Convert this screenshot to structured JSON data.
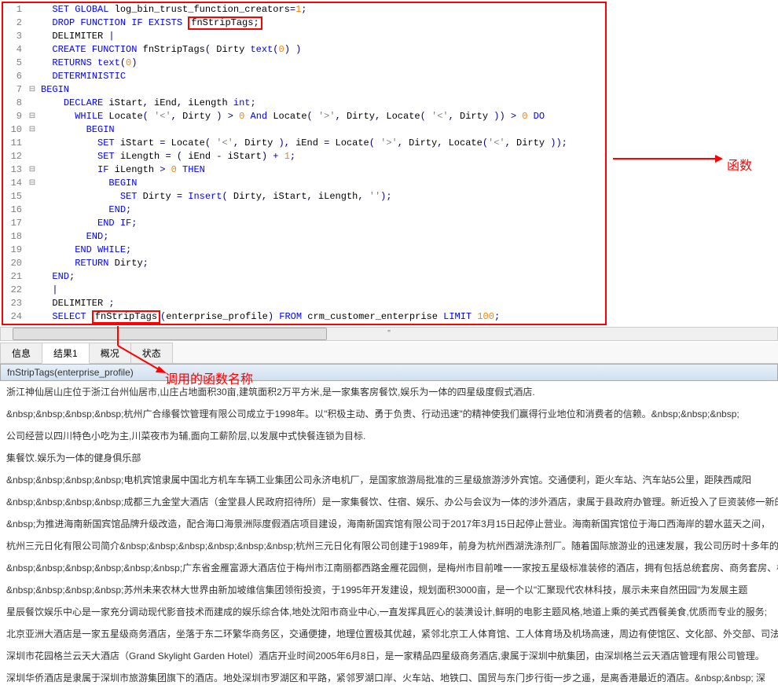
{
  "code": {
    "lines": [
      {
        "n": 1,
        "fold": "",
        "tokens": [
          {
            "t": "  ",
            "c": ""
          },
          {
            "t": "SET GLOBAL",
            "c": "kw"
          },
          {
            "t": " log_bin_trust_function_creators",
            "c": "id"
          },
          {
            "t": "=",
            "c": "op"
          },
          {
            "t": "1",
            "c": "num"
          },
          {
            "t": ";",
            "c": "op"
          }
        ]
      },
      {
        "n": 2,
        "fold": "",
        "tokens": [
          {
            "t": "  ",
            "c": ""
          },
          {
            "t": "DROP FUNCTION IF EXISTS",
            "c": "kw"
          },
          {
            "t": " ",
            "c": ""
          },
          {
            "t": "fnStripTags;",
            "c": "id",
            "box": true
          }
        ]
      },
      {
        "n": 3,
        "fold": "",
        "tokens": [
          {
            "t": "  DELIMITER ",
            "c": "id"
          },
          {
            "t": "|",
            "c": "op"
          }
        ]
      },
      {
        "n": 4,
        "fold": "",
        "tokens": [
          {
            "t": "  ",
            "c": ""
          },
          {
            "t": "CREATE FUNCTION",
            "c": "kw"
          },
          {
            "t": " fnStripTags",
            "c": "id"
          },
          {
            "t": "(",
            "c": "op"
          },
          {
            "t": " Dirty ",
            "c": "id"
          },
          {
            "t": "text",
            "c": "kw"
          },
          {
            "t": "(",
            "c": "op"
          },
          {
            "t": "0",
            "c": "num"
          },
          {
            "t": ") )",
            "c": "op"
          }
        ]
      },
      {
        "n": 5,
        "fold": "",
        "tokens": [
          {
            "t": "  ",
            "c": ""
          },
          {
            "t": "RETURNS",
            "c": "kw"
          },
          {
            "t": " ",
            "c": ""
          },
          {
            "t": "text",
            "c": "kw"
          },
          {
            "t": "(",
            "c": "op"
          },
          {
            "t": "0",
            "c": "num"
          },
          {
            "t": ")",
            "c": "op"
          }
        ]
      },
      {
        "n": 6,
        "fold": "",
        "tokens": [
          {
            "t": "  ",
            "c": ""
          },
          {
            "t": "DETERMINISTIC",
            "c": "kw"
          }
        ]
      },
      {
        "n": 7,
        "fold": "⊟",
        "tokens": [
          {
            "t": "BEGIN",
            "c": "kw"
          }
        ]
      },
      {
        "n": 8,
        "fold": "",
        "tokens": [
          {
            "t": "    ",
            "c": ""
          },
          {
            "t": "DECLARE",
            "c": "kw"
          },
          {
            "t": " iStart",
            "c": "id"
          },
          {
            "t": ",",
            "c": "op"
          },
          {
            "t": " iEnd",
            "c": "id"
          },
          {
            "t": ",",
            "c": "op"
          },
          {
            "t": " iLength ",
            "c": "id"
          },
          {
            "t": "int",
            "c": "kw"
          },
          {
            "t": ";",
            "c": "op"
          }
        ]
      },
      {
        "n": 9,
        "fold": "⊟",
        "tokens": [
          {
            "t": "      ",
            "c": ""
          },
          {
            "t": "WHILE",
            "c": "kw"
          },
          {
            "t": " Locate",
            "c": "id"
          },
          {
            "t": "( ",
            "c": "op"
          },
          {
            "t": "'<'",
            "c": "str"
          },
          {
            "t": ",",
            "c": "op"
          },
          {
            "t": " Dirty ",
            "c": "id"
          },
          {
            "t": ") > ",
            "c": "op"
          },
          {
            "t": "0",
            "c": "num"
          },
          {
            "t": " ",
            "c": ""
          },
          {
            "t": "And",
            "c": "kw"
          },
          {
            "t": " Locate",
            "c": "id"
          },
          {
            "t": "( ",
            "c": "op"
          },
          {
            "t": "'>'",
            "c": "str"
          },
          {
            "t": ",",
            "c": "op"
          },
          {
            "t": " Dirty",
            "c": "id"
          },
          {
            "t": ",",
            "c": "op"
          },
          {
            "t": " Locate",
            "c": "id"
          },
          {
            "t": "( ",
            "c": "op"
          },
          {
            "t": "'<'",
            "c": "str"
          },
          {
            "t": ",",
            "c": "op"
          },
          {
            "t": " Dirty ",
            "c": "id"
          },
          {
            "t": ")) > ",
            "c": "op"
          },
          {
            "t": "0",
            "c": "num"
          },
          {
            "t": " ",
            "c": ""
          },
          {
            "t": "DO",
            "c": "kw"
          }
        ]
      },
      {
        "n": 10,
        "fold": "⊟",
        "tokens": [
          {
            "t": "        ",
            "c": ""
          },
          {
            "t": "BEGIN",
            "c": "kw"
          }
        ]
      },
      {
        "n": 11,
        "fold": "",
        "tokens": [
          {
            "t": "          ",
            "c": ""
          },
          {
            "t": "SET",
            "c": "kw"
          },
          {
            "t": " iStart ",
            "c": "id"
          },
          {
            "t": "=",
            "c": "op"
          },
          {
            "t": " Locate",
            "c": "id"
          },
          {
            "t": "( ",
            "c": "op"
          },
          {
            "t": "'<'",
            "c": "str"
          },
          {
            "t": ",",
            "c": "op"
          },
          {
            "t": " Dirty ",
            "c": "id"
          },
          {
            "t": "),",
            "c": "op"
          },
          {
            "t": " iEnd ",
            "c": "id"
          },
          {
            "t": "=",
            "c": "op"
          },
          {
            "t": " Locate",
            "c": "id"
          },
          {
            "t": "( ",
            "c": "op"
          },
          {
            "t": "'>'",
            "c": "str"
          },
          {
            "t": ",",
            "c": "op"
          },
          {
            "t": " Dirty",
            "c": "id"
          },
          {
            "t": ",",
            "c": "op"
          },
          {
            "t": " Locate",
            "c": "id"
          },
          {
            "t": "(",
            "c": "op"
          },
          {
            "t": "'<'",
            "c": "str"
          },
          {
            "t": ",",
            "c": "op"
          },
          {
            "t": " Dirty ",
            "c": "id"
          },
          {
            "t": "));",
            "c": "op"
          }
        ]
      },
      {
        "n": 12,
        "fold": "",
        "tokens": [
          {
            "t": "          ",
            "c": ""
          },
          {
            "t": "SET",
            "c": "kw"
          },
          {
            "t": " iLength ",
            "c": "id"
          },
          {
            "t": "= (",
            "c": "op"
          },
          {
            "t": " iEnd ",
            "c": "id"
          },
          {
            "t": "-",
            "c": "op"
          },
          {
            "t": " iStart",
            "c": "id"
          },
          {
            "t": ") + ",
            "c": "op"
          },
          {
            "t": "1",
            "c": "num"
          },
          {
            "t": ";",
            "c": "op"
          }
        ]
      },
      {
        "n": 13,
        "fold": "⊟",
        "tokens": [
          {
            "t": "          ",
            "c": ""
          },
          {
            "t": "IF",
            "c": "kw"
          },
          {
            "t": " iLength ",
            "c": "id"
          },
          {
            "t": "> ",
            "c": "op"
          },
          {
            "t": "0",
            "c": "num"
          },
          {
            "t": " ",
            "c": ""
          },
          {
            "t": "THEN",
            "c": "kw"
          }
        ]
      },
      {
        "n": 14,
        "fold": "⊟",
        "tokens": [
          {
            "t": "            ",
            "c": ""
          },
          {
            "t": "BEGIN",
            "c": "kw"
          }
        ]
      },
      {
        "n": 15,
        "fold": "",
        "tokens": [
          {
            "t": "              ",
            "c": ""
          },
          {
            "t": "SET",
            "c": "kw"
          },
          {
            "t": " Dirty ",
            "c": "id"
          },
          {
            "t": "=",
            "c": "op"
          },
          {
            "t": " ",
            "c": ""
          },
          {
            "t": "Insert",
            "c": "kw"
          },
          {
            "t": "(",
            "c": "op"
          },
          {
            "t": " Dirty",
            "c": "id"
          },
          {
            "t": ",",
            "c": "op"
          },
          {
            "t": " iStart",
            "c": "id"
          },
          {
            "t": ",",
            "c": "op"
          },
          {
            "t": " iLength",
            "c": "id"
          },
          {
            "t": ", ",
            "c": "op"
          },
          {
            "t": "''",
            "c": "str"
          },
          {
            "t": ");",
            "c": "op"
          }
        ]
      },
      {
        "n": 16,
        "fold": "",
        "tokens": [
          {
            "t": "            ",
            "c": ""
          },
          {
            "t": "END",
            "c": "kw"
          },
          {
            "t": ";",
            "c": "op"
          }
        ]
      },
      {
        "n": 17,
        "fold": "",
        "tokens": [
          {
            "t": "          ",
            "c": ""
          },
          {
            "t": "END IF",
            "c": "kw"
          },
          {
            "t": ";",
            "c": "op"
          }
        ]
      },
      {
        "n": 18,
        "fold": "",
        "tokens": [
          {
            "t": "        ",
            "c": ""
          },
          {
            "t": "END",
            "c": "kw"
          },
          {
            "t": ";",
            "c": "op"
          }
        ]
      },
      {
        "n": 19,
        "fold": "",
        "tokens": [
          {
            "t": "      ",
            "c": ""
          },
          {
            "t": "END WHILE",
            "c": "kw"
          },
          {
            "t": ";",
            "c": "op"
          }
        ]
      },
      {
        "n": 20,
        "fold": "",
        "tokens": [
          {
            "t": "      ",
            "c": ""
          },
          {
            "t": "RETURN",
            "c": "kw"
          },
          {
            "t": " Dirty",
            "c": "id"
          },
          {
            "t": ";",
            "c": "op"
          }
        ]
      },
      {
        "n": 21,
        "fold": "",
        "tokens": [
          {
            "t": "  ",
            "c": ""
          },
          {
            "t": "END",
            "c": "kw"
          },
          {
            "t": ";",
            "c": "op"
          }
        ]
      },
      {
        "n": 22,
        "fold": "",
        "tokens": [
          {
            "t": "  ",
            "c": ""
          },
          {
            "t": "|",
            "c": "op"
          }
        ]
      },
      {
        "n": 23,
        "fold": "",
        "tokens": [
          {
            "t": "  DELIMITER ",
            "c": "id"
          },
          {
            "t": ";",
            "c": "op"
          }
        ]
      },
      {
        "n": 24,
        "fold": "",
        "tokens": [
          {
            "t": "  ",
            "c": ""
          },
          {
            "t": "SELECT",
            "c": "kw"
          },
          {
            "t": " ",
            "c": ""
          },
          {
            "t": "fnStripTags",
            "c": "id",
            "box": true
          },
          {
            "t": "(",
            "c": "op"
          },
          {
            "t": "enterprise_profile",
            "c": "id"
          },
          {
            "t": ") ",
            "c": "op"
          },
          {
            "t": "FROM",
            "c": "kw"
          },
          {
            "t": " crm_customer_enterprise ",
            "c": "id"
          },
          {
            "t": "LIMIT",
            "c": "kw"
          },
          {
            "t": " ",
            "c": ""
          },
          {
            "t": "100",
            "c": "num"
          },
          {
            "t": ";",
            "c": "op"
          }
        ]
      }
    ]
  },
  "annotations": {
    "label1": "函数",
    "label2": "调用的函数名称"
  },
  "tabs": {
    "items": [
      "信息",
      "结果1",
      "概况",
      "状态"
    ],
    "active": 1
  },
  "results": {
    "column": "fnStripTags(enterprise_profile)",
    "rows": [
      "浙江神仙居山庄位于浙江台州仙居市,山庄占地面积30亩,建筑面积2万平方米,是一家集客房餐饮,娱乐为一体的四星级度假式酒店.",
      "&nbsp;&nbsp;&nbsp;&nbsp;杭州广合缘餐饮管理有限公司成立于1998年。以\"积极主动、勇于负责、行动迅速\"的精神使我们赢得行业地位和消费者的信赖。&nbsp;&nbsp;&nbsp;",
      "公司经营以四川特色小吃为主,川菜夜市为辅,面向工薪阶层,以发展中式快餐连锁为目标.",
      "集餐饮.娱乐为一体的健身俱乐部",
      "&nbsp;&nbsp;&nbsp;&nbsp;电机宾馆隶属中国北方机车车辆工业集团公司永济电机厂，是国家旅游局批准的三星级旅游涉外宾馆。交通便利，距火车站、汽车站5公里，距陕西咸阳",
      "&nbsp;&nbsp;&nbsp;&nbsp;成都三九金堂大酒店（金堂县人民政府招待所）是一家集餐饮、住宿、娱乐、办公与会议为一体的涉外酒店，隶属于县政府办管理。新近投入了巨资装修一新的城",
      "&nbsp;为推进海南新国宾馆品牌升级改造，配合海口海景洲际度假酒店项目建设，海南新国宾馆有限公司于2017年3月15日起停止营业。海南新国宾馆位于海口西海岸的碧水蓝天之间，",
      "杭州三元日化有限公司简介&nbsp;&nbsp;&nbsp;&nbsp;&nbsp;&nbsp;杭州三元日化有限公司创建于1989年，前身为杭州西湖洗涤剂厂。随着国际旅游业的迅速发展，我公司历时十多年的时间形成",
      "&nbsp;&nbsp;&nbsp;&nbsp;&nbsp;&nbsp;广东省金雁富源大酒店位于梅州市江南丽都西路金雁花园侧，是梅州市目前唯一一家按五星级标准装修的酒店，拥有包括总统套房、商务套房、标准间共",
      "&nbsp;&nbsp;&nbsp;&nbsp;苏州未来农林大世界由新加坡维信集团领衔投资，于1995年开发建设，规划面积3000亩，是一个以\"汇聚现代农林科技，展示未来自然田园\"为发展主题",
      "星辰餐饮娱乐中心是一家充分调动现代影音技术而建成的娱乐综合体,地处沈阳市商业中心,一直发挥具匠心的装潢设计,鲜明的电影主题风格,地道上乘的美式西餐美食,优质而专业的服务;",
      "北京亚洲大酒店是一家五星级商务酒店，坐落于东二环繁华商务区，交通便捷，地理位置极其优越，紧邻北京工人体育馆、工人体育场及机场高速，周边有使馆区、文化部、外交部、司法",
      "深圳市花园格兰云天大酒店（Grand Skylight Garden Hotel）酒店开业时间2005年6月8日，是一家精品四星级商务酒店,隶属于深圳中航集团，由深圳格兰云天酒店管理有限公司管理。",
      "深圳华侨酒店是隶属于深圳市旅游集团旗下的酒店。地处深圳市罗湖区和平路，紧邻罗湖口岸、火车站、地铁口、国贸与东门步行街一步之遥，是离香港最近的酒店。&nbsp;&nbsp; 深"
    ]
  },
  "scrollbar": {
    "marker": "''"
  }
}
